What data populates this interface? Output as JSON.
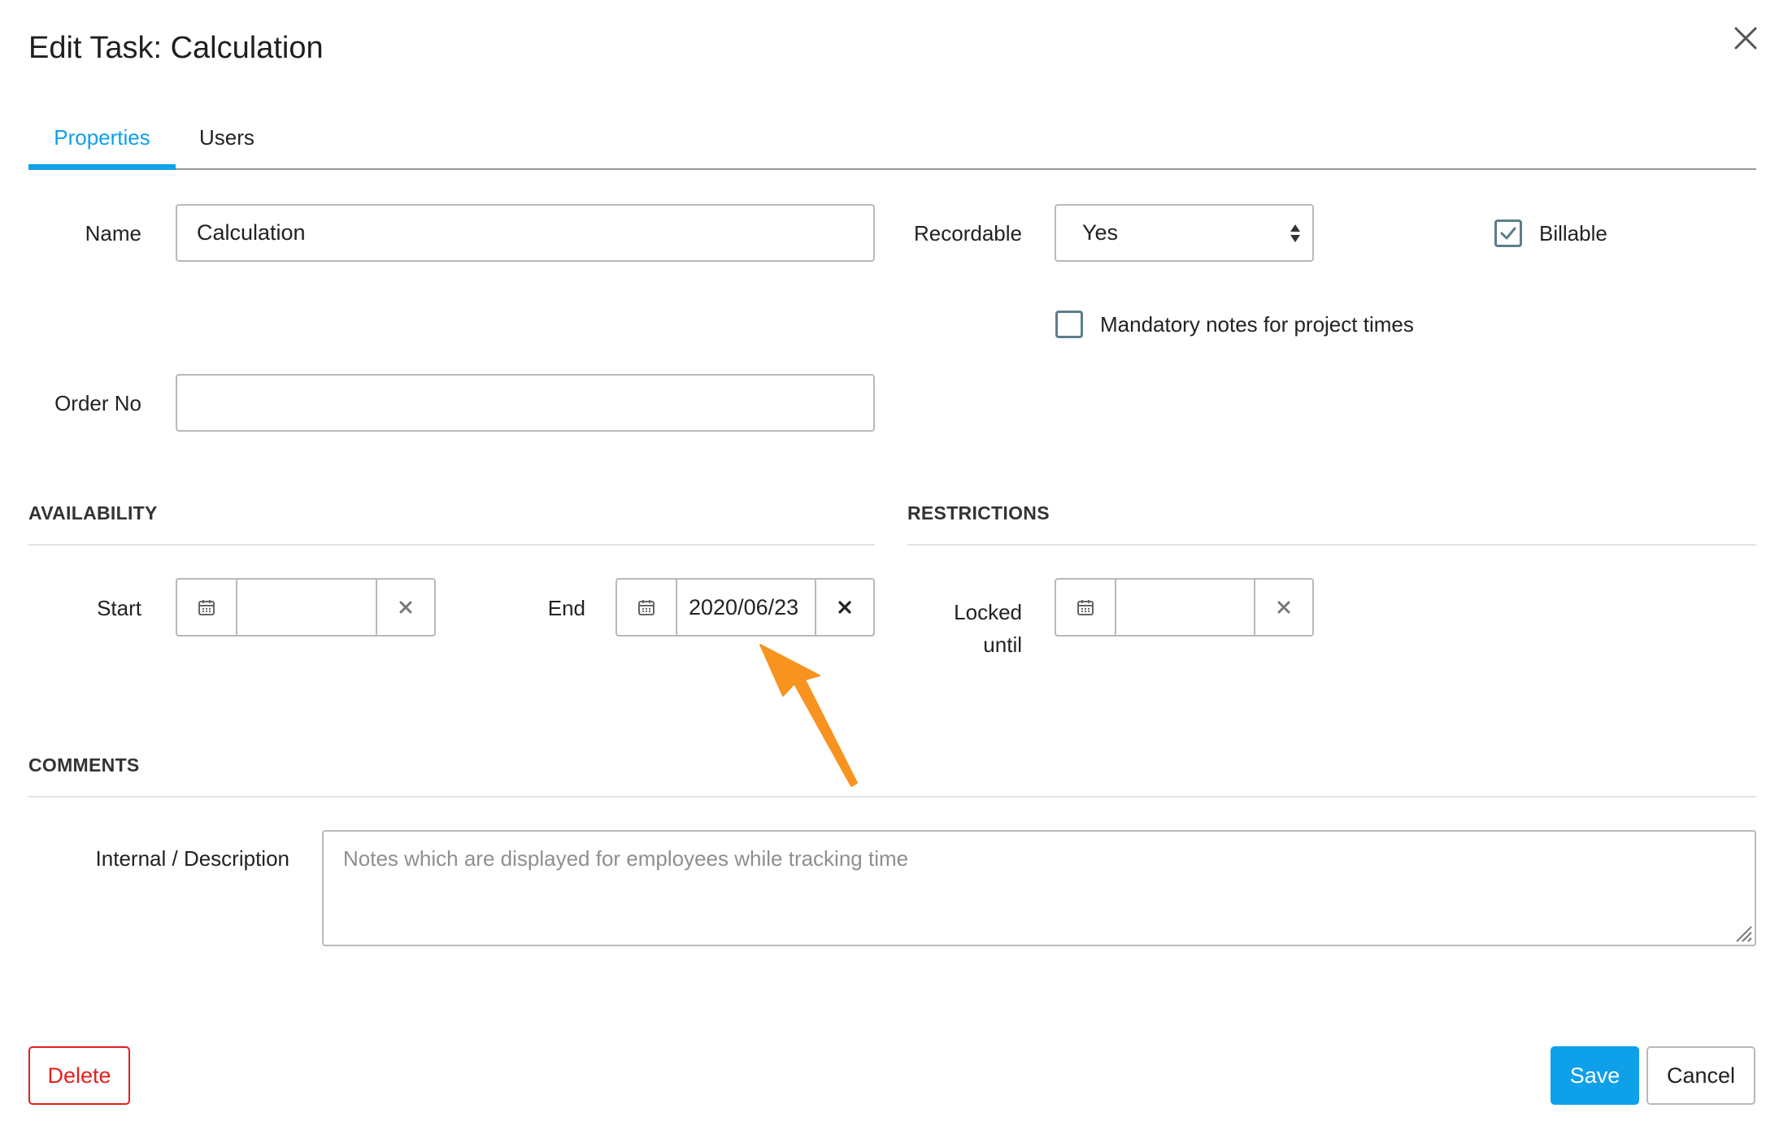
{
  "dialog": {
    "title": "Edit Task: Calculation"
  },
  "tabs": [
    {
      "label": "Properties",
      "active": true
    },
    {
      "label": "Users",
      "active": false
    }
  ],
  "form": {
    "name": {
      "label": "Name",
      "value": "Calculation"
    },
    "recordable": {
      "label": "Recordable",
      "value": "Yes"
    },
    "billable": {
      "label": "Billable",
      "checked": true
    },
    "mandatory_notes": {
      "label": "Mandatory notes for project times",
      "checked": false
    },
    "order_no": {
      "label": "Order No",
      "value": ""
    }
  },
  "sections": {
    "availability": "AVAILABILITY",
    "restrictions": "RESTRICTIONS",
    "comments": "COMMENTS"
  },
  "availability": {
    "start": {
      "label": "Start",
      "value": ""
    },
    "end": {
      "label": "End",
      "value": "2020/06/23"
    }
  },
  "restrictions": {
    "locked_until": {
      "label_line1": "Locked",
      "label_line2": "until",
      "value": ""
    }
  },
  "comments": {
    "description_label": "Internal / Description",
    "description_placeholder": "Notes which are displayed for employees while tracking time",
    "description_value": ""
  },
  "buttons": {
    "delete": "Delete",
    "save": "Save",
    "cancel": "Cancel"
  },
  "colors": {
    "accent": "#0fa0ea",
    "danger": "#e31f1f",
    "annotation_arrow": "#f7931e"
  },
  "icons": [
    "close-icon",
    "calendar-icon",
    "clear-icon",
    "select-arrows-icon",
    "checkmark-icon",
    "resize-handle-icon",
    "annotation-arrow"
  ]
}
